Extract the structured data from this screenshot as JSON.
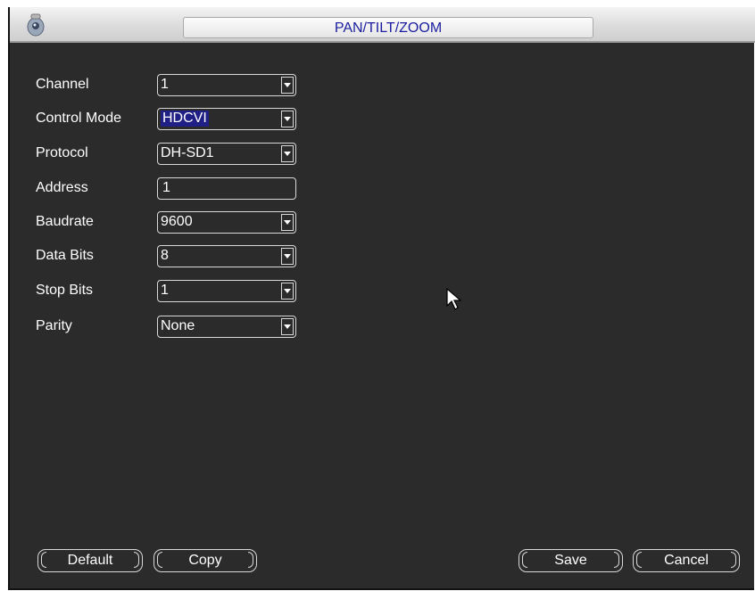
{
  "window": {
    "title": "PAN/TILT/ZOOM"
  },
  "icons": {
    "app": "camera-icon",
    "dropdown": "chevron-down-icon",
    "cursor": "mouse-pointer-icon"
  },
  "fields": [
    {
      "label": "Channel",
      "type": "select",
      "value": "1"
    },
    {
      "label": "Control Mode",
      "type": "select",
      "value": "HDCVI"
    },
    {
      "label": "Protocol",
      "type": "select",
      "value": "DH-SD1"
    },
    {
      "label": "Address",
      "type": "input",
      "value": "1"
    },
    {
      "label": "Baudrate",
      "type": "select",
      "value": "9600"
    },
    {
      "label": "Data Bits",
      "type": "select",
      "value": "8"
    },
    {
      "label": "Stop Bits",
      "type": "select",
      "value": "1"
    },
    {
      "label": "Parity",
      "type": "select",
      "value": "None"
    }
  ],
  "buttons": {
    "default": "Default",
    "copy": "Copy",
    "save": "Save",
    "cancel": "Cancel"
  },
  "colors": {
    "background": "#2b2b2b",
    "title_text": "#1a1e9e",
    "highlight": "#1f1f86"
  }
}
